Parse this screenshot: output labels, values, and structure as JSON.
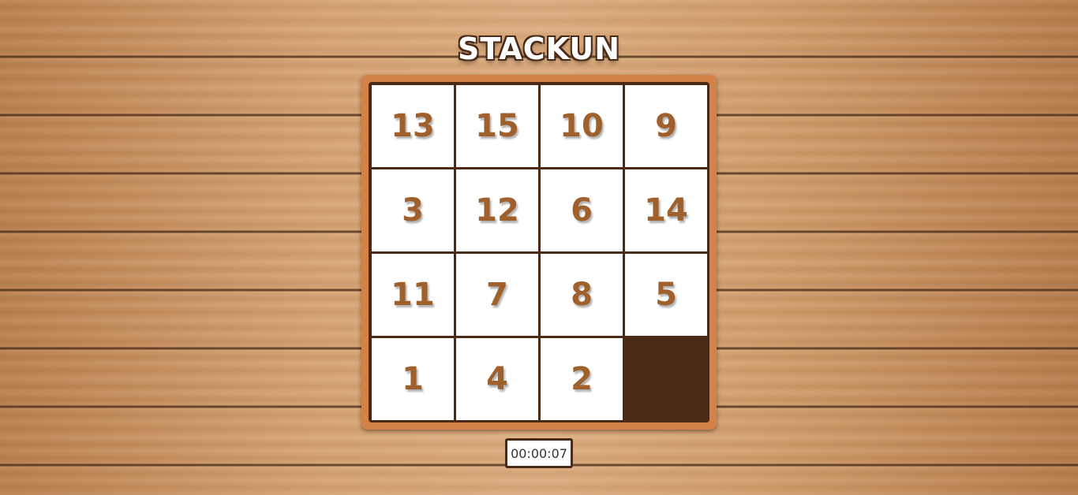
{
  "title": "STACKUN",
  "board": {
    "tiles": [
      {
        "label": "13"
      },
      {
        "label": "15"
      },
      {
        "label": "10"
      },
      {
        "label": "9"
      },
      {
        "label": "3"
      },
      {
        "label": "12"
      },
      {
        "label": "6"
      },
      {
        "label": "14"
      },
      {
        "label": "11"
      },
      {
        "label": "7"
      },
      {
        "label": "8"
      },
      {
        "label": "5"
      },
      {
        "label": "1"
      },
      {
        "label": "4"
      },
      {
        "label": "2"
      },
      {
        "label": ""
      }
    ],
    "empty_index": 15
  },
  "timer": {
    "value": "00:00:07"
  },
  "colors": {
    "tile_text": "#a0602c",
    "frame": "#d4824a",
    "board_dark": "#4a2a14",
    "tile_bg": "#ffffff"
  }
}
